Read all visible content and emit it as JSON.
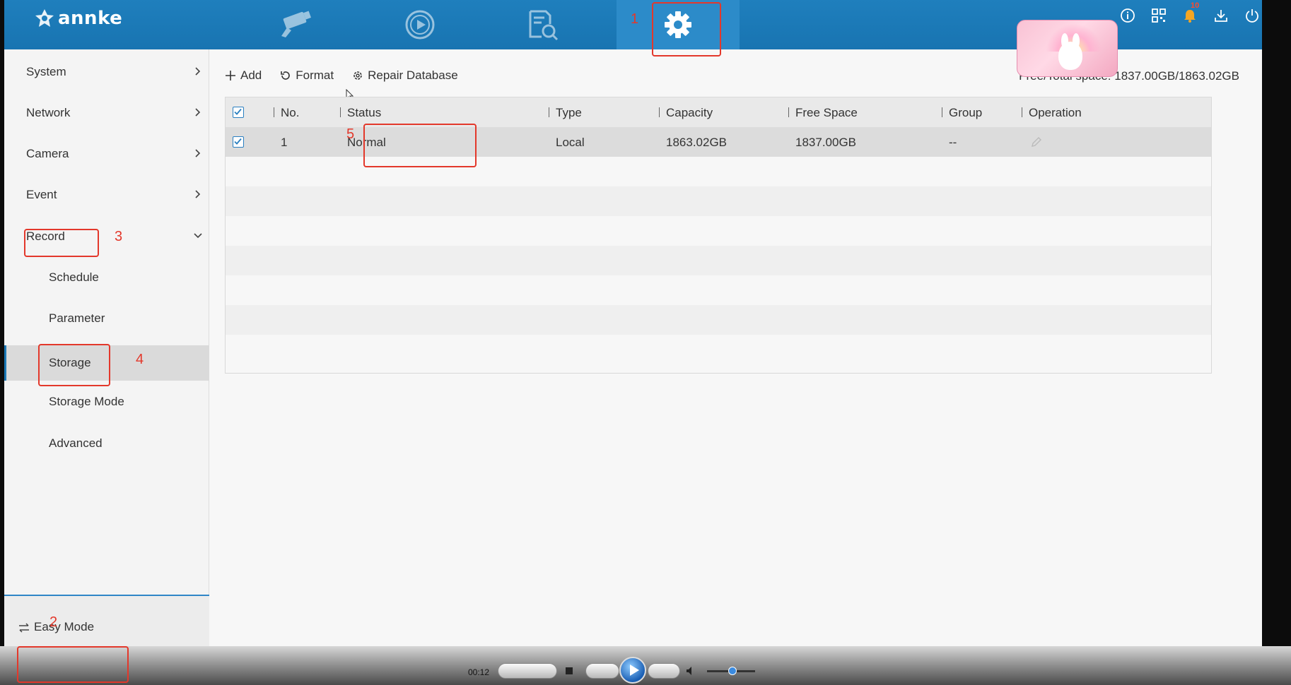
{
  "app": {
    "brand": "annke"
  },
  "topnav": [
    {
      "id": "live-view",
      "icon": "camera-icon"
    },
    {
      "id": "playback",
      "icon": "playback-icon"
    },
    {
      "id": "search",
      "icon": "file-search-icon"
    },
    {
      "id": "configuration",
      "icon": "gear-icon",
      "active": true
    }
  ],
  "topicons": [
    "info-icon",
    "qr-code-icon",
    "bell-icon",
    "download-icon",
    "power-icon"
  ],
  "notifications": {
    "count": "10"
  },
  "sidebar": {
    "items": [
      {
        "label": "System",
        "expandable": true
      },
      {
        "label": "Network",
        "expandable": true
      },
      {
        "label": "Camera",
        "expandable": true
      },
      {
        "label": "Event",
        "expandable": true
      },
      {
        "label": "Record",
        "expanded": true
      }
    ],
    "record_subitems": [
      {
        "label": "Schedule"
      },
      {
        "label": "Parameter"
      },
      {
        "label": "Storage",
        "selected": true
      },
      {
        "label": "Storage Mode"
      },
      {
        "label": "Advanced"
      }
    ],
    "easy_mode": "Easy Mode"
  },
  "toolbar": {
    "add": "Add",
    "format": "Format",
    "repair": "Repair Database"
  },
  "free_space": "Free/Total space: 1837.00GB/1863.02GB",
  "table": {
    "headers": {
      "no": "No.",
      "status": "Status",
      "type": "Type",
      "capacity": "Capacity",
      "free_space": "Free Space",
      "group": "Group",
      "operation": "Operation"
    },
    "rows": [
      {
        "no": "1",
        "status": "Normal",
        "type": "Local",
        "capacity": "1863.02GB",
        "free_space": "1837.00GB",
        "group": "--"
      }
    ]
  },
  "annotations": [
    "1",
    "2",
    "3",
    "4",
    "5"
  ],
  "player": {
    "time": "00:12"
  },
  "colors": {
    "header": "#1b78b6",
    "accent": "#2a7fc0",
    "annotation": "#e3382b"
  }
}
